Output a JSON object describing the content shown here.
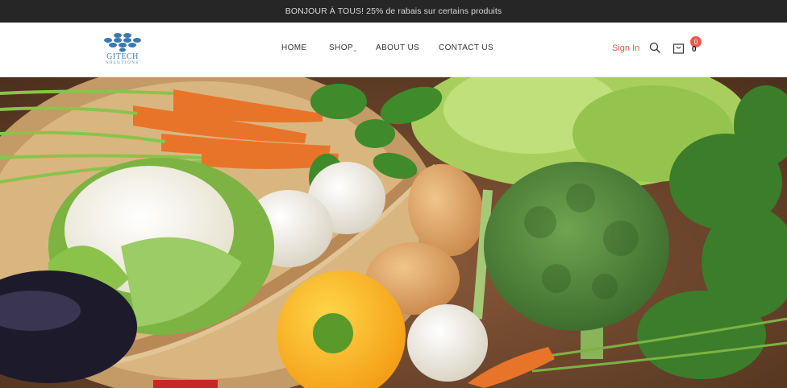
{
  "promo": {
    "text": "BONJOUR À TOUS! 25% de rabais sur certains produits"
  },
  "logo": {
    "name": "GITECH",
    "tagline": "SOLUTIONS"
  },
  "nav": {
    "items": [
      {
        "label": "HOME"
      },
      {
        "label": "SHOP"
      },
      {
        "label": "ABOUT US"
      },
      {
        "label": "CONTACT US"
      }
    ]
  },
  "account": {
    "signin_label": "Sign In"
  },
  "cart": {
    "badge": "0",
    "count": "0"
  },
  "colors": {
    "topbar_bg": "#262626",
    "accent": "#e2584a",
    "badge": "#e85a4f",
    "logo_blue": "#3a78b0"
  },
  "icons": [
    "search-icon",
    "cart-icon",
    "chevron-down-icon"
  ],
  "hero": {
    "image": "vegetables-banner"
  }
}
